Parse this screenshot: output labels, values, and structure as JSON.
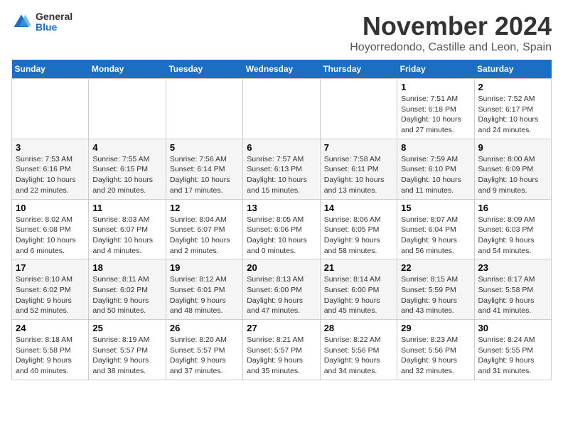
{
  "logo": {
    "general": "General",
    "blue": "Blue"
  },
  "title": "November 2024",
  "location": "Hoyorredondo, Castille and Leon, Spain",
  "days_header": [
    "Sunday",
    "Monday",
    "Tuesday",
    "Wednesday",
    "Thursday",
    "Friday",
    "Saturday"
  ],
  "weeks": [
    [
      {
        "day": "",
        "info": ""
      },
      {
        "day": "",
        "info": ""
      },
      {
        "day": "",
        "info": ""
      },
      {
        "day": "",
        "info": ""
      },
      {
        "day": "",
        "info": ""
      },
      {
        "day": "1",
        "info": "Sunrise: 7:51 AM\nSunset: 6:18 PM\nDaylight: 10 hours and 27 minutes."
      },
      {
        "day": "2",
        "info": "Sunrise: 7:52 AM\nSunset: 6:17 PM\nDaylight: 10 hours and 24 minutes."
      }
    ],
    [
      {
        "day": "3",
        "info": "Sunrise: 7:53 AM\nSunset: 6:16 PM\nDaylight: 10 hours and 22 minutes."
      },
      {
        "day": "4",
        "info": "Sunrise: 7:55 AM\nSunset: 6:15 PM\nDaylight: 10 hours and 20 minutes."
      },
      {
        "day": "5",
        "info": "Sunrise: 7:56 AM\nSunset: 6:14 PM\nDaylight: 10 hours and 17 minutes."
      },
      {
        "day": "6",
        "info": "Sunrise: 7:57 AM\nSunset: 6:13 PM\nDaylight: 10 hours and 15 minutes."
      },
      {
        "day": "7",
        "info": "Sunrise: 7:58 AM\nSunset: 6:11 PM\nDaylight: 10 hours and 13 minutes."
      },
      {
        "day": "8",
        "info": "Sunrise: 7:59 AM\nSunset: 6:10 PM\nDaylight: 10 hours and 11 minutes."
      },
      {
        "day": "9",
        "info": "Sunrise: 8:00 AM\nSunset: 6:09 PM\nDaylight: 10 hours and 9 minutes."
      }
    ],
    [
      {
        "day": "10",
        "info": "Sunrise: 8:02 AM\nSunset: 6:08 PM\nDaylight: 10 hours and 6 minutes."
      },
      {
        "day": "11",
        "info": "Sunrise: 8:03 AM\nSunset: 6:07 PM\nDaylight: 10 hours and 4 minutes."
      },
      {
        "day": "12",
        "info": "Sunrise: 8:04 AM\nSunset: 6:07 PM\nDaylight: 10 hours and 2 minutes."
      },
      {
        "day": "13",
        "info": "Sunrise: 8:05 AM\nSunset: 6:06 PM\nDaylight: 10 hours and 0 minutes."
      },
      {
        "day": "14",
        "info": "Sunrise: 8:06 AM\nSunset: 6:05 PM\nDaylight: 9 hours and 58 minutes."
      },
      {
        "day": "15",
        "info": "Sunrise: 8:07 AM\nSunset: 6:04 PM\nDaylight: 9 hours and 56 minutes."
      },
      {
        "day": "16",
        "info": "Sunrise: 8:09 AM\nSunset: 6:03 PM\nDaylight: 9 hours and 54 minutes."
      }
    ],
    [
      {
        "day": "17",
        "info": "Sunrise: 8:10 AM\nSunset: 6:02 PM\nDaylight: 9 hours and 52 minutes."
      },
      {
        "day": "18",
        "info": "Sunrise: 8:11 AM\nSunset: 6:02 PM\nDaylight: 9 hours and 50 minutes."
      },
      {
        "day": "19",
        "info": "Sunrise: 8:12 AM\nSunset: 6:01 PM\nDaylight: 9 hours and 48 minutes."
      },
      {
        "day": "20",
        "info": "Sunrise: 8:13 AM\nSunset: 6:00 PM\nDaylight: 9 hours and 47 minutes."
      },
      {
        "day": "21",
        "info": "Sunrise: 8:14 AM\nSunset: 6:00 PM\nDaylight: 9 hours and 45 minutes."
      },
      {
        "day": "22",
        "info": "Sunrise: 8:15 AM\nSunset: 5:59 PM\nDaylight: 9 hours and 43 minutes."
      },
      {
        "day": "23",
        "info": "Sunrise: 8:17 AM\nSunset: 5:58 PM\nDaylight: 9 hours and 41 minutes."
      }
    ],
    [
      {
        "day": "24",
        "info": "Sunrise: 8:18 AM\nSunset: 5:58 PM\nDaylight: 9 hours and 40 minutes."
      },
      {
        "day": "25",
        "info": "Sunrise: 8:19 AM\nSunset: 5:57 PM\nDaylight: 9 hours and 38 minutes."
      },
      {
        "day": "26",
        "info": "Sunrise: 8:20 AM\nSunset: 5:57 PM\nDaylight: 9 hours and 37 minutes."
      },
      {
        "day": "27",
        "info": "Sunrise: 8:21 AM\nSunset: 5:57 PM\nDaylight: 9 hours and 35 minutes."
      },
      {
        "day": "28",
        "info": "Sunrise: 8:22 AM\nSunset: 5:56 PM\nDaylight: 9 hours and 34 minutes."
      },
      {
        "day": "29",
        "info": "Sunrise: 8:23 AM\nSunset: 5:56 PM\nDaylight: 9 hours and 32 minutes."
      },
      {
        "day": "30",
        "info": "Sunrise: 8:24 AM\nSunset: 5:55 PM\nDaylight: 9 hours and 31 minutes."
      }
    ]
  ]
}
